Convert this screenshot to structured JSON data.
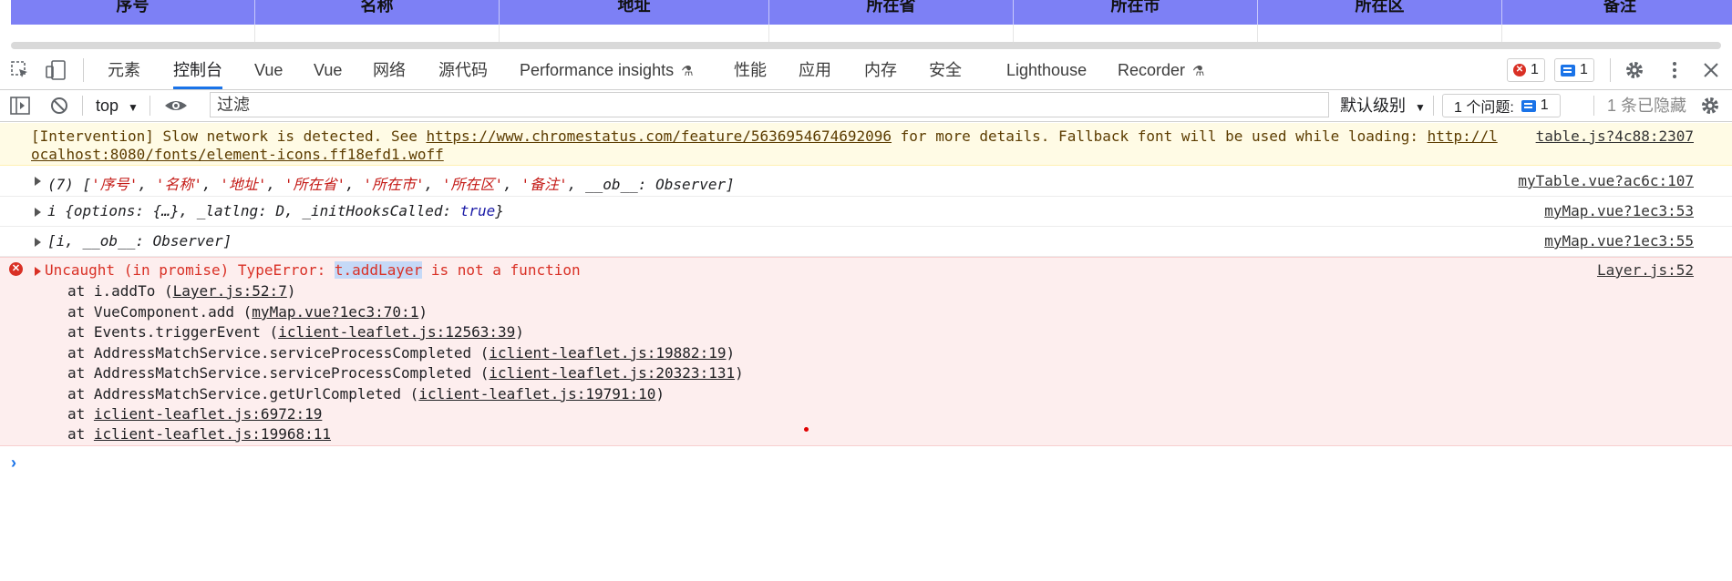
{
  "page_table": {
    "headers": [
      "序号",
      "名称",
      "地址",
      "所在省",
      "所在市",
      "所在区",
      "备注"
    ]
  },
  "devtools": {
    "tabs": [
      "元素",
      "控制台",
      "Vue",
      "Vue",
      "网络",
      "源代码",
      "Performance insights",
      "性能",
      "应用",
      "内存",
      "安全",
      "Lighthouse",
      "Recorder"
    ],
    "active_tab": "控制台",
    "error_count": "1",
    "message_count": "1"
  },
  "filterbar": {
    "context": "top",
    "filter_placeholder": "过滤",
    "level": "默认级别",
    "issues_label": "1 个问题:",
    "issues_count": "1",
    "hidden": "1 条已隐藏"
  },
  "console": {
    "warning": {
      "line1_prefix": "[Intervention] Slow network is detected. See ",
      "line1_link": "https://www.chromestatus.com/feature/5636954674692096",
      "line1_mid": " for more details. Fallback font will be used while loading: ",
      "line1_link2": "http://l",
      "line2_link": "ocalhost:8080/fonts/element-icons.ff18efd1.woff",
      "source": "table.js?4c88:2307"
    },
    "log1": {
      "prefix": "(7) [",
      "items": [
        "'序号'",
        "'名称'",
        "'地址'",
        "'所在省'",
        "'所在市'",
        "'所在区'",
        "'备注'"
      ],
      "suffix": ", __ob__: Observer]",
      "source": "myTable.vue?ac6c:107"
    },
    "log2": {
      "a": "i {options: {…}, _latlng: D, _initHooksCalled: ",
      "b": "true",
      "c": "}",
      "source": "myMap.vue?1ec3:53"
    },
    "log3": {
      "text": "[i, __ob__: Observer]",
      "source": "myMap.vue?1ec3:55"
    },
    "error": {
      "prefix": "Uncaught (in promise) TypeError: ",
      "highlight": "t.addLayer",
      "suffix": " is not a function",
      "source": "Layer.js:52",
      "stack": [
        {
          "fn": "at i.addTo (",
          "loc": "Layer.js:52:7",
          "end": ")"
        },
        {
          "fn": "at VueComponent.add (",
          "loc": "myMap.vue?1ec3:70:1",
          "end": ")"
        },
        {
          "fn": "at Events.triggerEvent (",
          "loc": "iclient-leaflet.js:12563:39",
          "end": ")"
        },
        {
          "fn": "at AddressMatchService.serviceProcessCompleted (",
          "loc": "iclient-leaflet.js:19882:19",
          "end": ")"
        },
        {
          "fn": "at AddressMatchService.serviceProcessCompleted (",
          "loc": "iclient-leaflet.js:20323:131",
          "end": ")"
        },
        {
          "fn": "at AddressMatchService.getUrlCompleted (",
          "loc": "iclient-leaflet.js:19791:10",
          "end": ")"
        },
        {
          "fn": "at ",
          "loc": "iclient-leaflet.js:6972:19",
          "end": ""
        },
        {
          "fn": "at ",
          "loc": "iclient-leaflet.js:19968:11",
          "end": ""
        }
      ]
    },
    "prompt": "›"
  }
}
